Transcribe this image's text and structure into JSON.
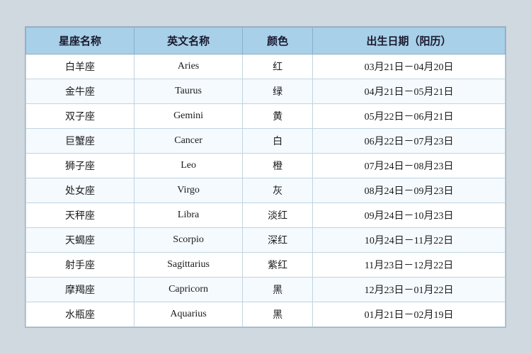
{
  "table": {
    "headers": [
      "星座名称",
      "英文名称",
      "颜色",
      "出生日期（阳历）"
    ],
    "rows": [
      [
        "白羊座",
        "Aries",
        "红",
        "03月21日－04月20日"
      ],
      [
        "金牛座",
        "Taurus",
        "绿",
        "04月21日－05月21日"
      ],
      [
        "双子座",
        "Gemini",
        "黄",
        "05月22日－06月21日"
      ],
      [
        "巨蟹座",
        "Cancer",
        "白",
        "06月22日－07月23日"
      ],
      [
        "狮子座",
        "Leo",
        "橙",
        "07月24日－08月23日"
      ],
      [
        "处女座",
        "Virgo",
        "灰",
        "08月24日－09月23日"
      ],
      [
        "天秤座",
        "Libra",
        "淡红",
        "09月24日－10月23日"
      ],
      [
        "天蝎座",
        "Scorpio",
        "深红",
        "10月24日－11月22日"
      ],
      [
        "射手座",
        "Sagittarius",
        "紫红",
        "11月23日－12月22日"
      ],
      [
        "摩羯座",
        "Capricorn",
        "黑",
        "12月23日－01月22日"
      ],
      [
        "水瓶座",
        "Aquarius",
        "黑",
        "01月21日－02月19日"
      ]
    ]
  }
}
